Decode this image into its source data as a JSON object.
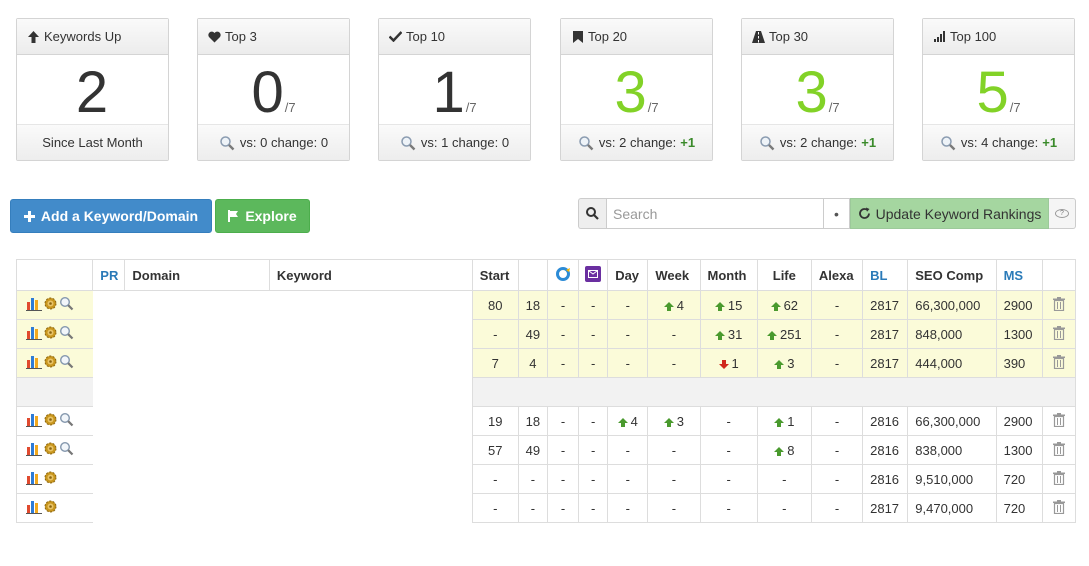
{
  "cards": [
    {
      "icon": "arrow-up-icon",
      "title": "Keywords Up",
      "value": "2",
      "of": "",
      "footer_vs": "Since Last Month",
      "change": "",
      "green": false,
      "search": false
    },
    {
      "icon": "heart-icon",
      "title": "Top 3",
      "value": "0",
      "of": "/7",
      "footer_vs": "vs: 0 change: 0",
      "change": "",
      "green": false,
      "search": true
    },
    {
      "icon": "checkmark-icon",
      "title": "Top 10",
      "value": "1",
      "of": "/7",
      "footer_vs": "vs: 1 change: 0",
      "change": "",
      "green": false,
      "search": true
    },
    {
      "icon": "bookmark-icon",
      "title": "Top 20",
      "value": "3",
      "of": "/7",
      "footer_vs": "vs: 2 change:",
      "change": "+1",
      "green": true,
      "search": true
    },
    {
      "icon": "road-icon",
      "title": "Top 30",
      "value": "3",
      "of": "/7",
      "footer_vs": "vs: 2 change:",
      "change": "+1",
      "green": true,
      "search": true
    },
    {
      "icon": "signal-icon",
      "title": "Top 100",
      "value": "5",
      "of": "/7",
      "footer_vs": "vs: 4 change:",
      "change": "+1",
      "green": true,
      "search": true
    }
  ],
  "toolbar": {
    "add_label": "Add a Keyword/Domain",
    "explore_label": "Explore",
    "search_placeholder": "Search",
    "dot": "•",
    "update_label": "Update Keyword Rankings",
    "help": "?"
  },
  "table": {
    "headers": {
      "pr": "PR",
      "domain": "Domain",
      "keyword": "Keyword",
      "start": "Start",
      "day": "Day",
      "week": "Week",
      "month": "Month",
      "life": "Life",
      "alexa": "Alexa",
      "bl": "BL",
      "seo": "SEO Comp",
      "ms": "MS"
    },
    "rows": [
      {
        "kind": "yellow",
        "search": true,
        "start": "80",
        "cur": "18",
        "bing": "-",
        "yahoo": "-",
        "day": "-",
        "day_dir": "",
        "week": "4",
        "week_dir": "up",
        "month": "15",
        "month_dir": "up",
        "life": "62",
        "life_dir": "up",
        "alexa": "-",
        "bl": "2817",
        "seo": "66,300,000",
        "ms": "2900"
      },
      {
        "kind": "yellow",
        "search": true,
        "start": "-",
        "cur": "49",
        "bing": "-",
        "yahoo": "-",
        "day": "-",
        "day_dir": "",
        "week": "-",
        "week_dir": "",
        "month": "31",
        "month_dir": "up",
        "life": "251",
        "life_dir": "up",
        "alexa": "-",
        "bl": "2817",
        "seo": "848,000",
        "ms": "1300"
      },
      {
        "kind": "yellow",
        "search": true,
        "start": "7",
        "cur": "4",
        "bing": "-",
        "yahoo": "-",
        "day": "-",
        "day_dir": "",
        "week": "-",
        "week_dir": "",
        "month": "1",
        "month_dir": "down",
        "life": "3",
        "life_dir": "up",
        "alexa": "-",
        "bl": "2817",
        "seo": "444,000",
        "ms": "390"
      },
      {
        "kind": "sep"
      },
      {
        "kind": "white",
        "search": true,
        "start": "19",
        "cur": "18",
        "bing": "-",
        "yahoo": "-",
        "day": "4",
        "day_dir": "up",
        "week": "3",
        "week_dir": "up",
        "month": "-",
        "month_dir": "",
        "life": "1",
        "life_dir": "up",
        "alexa": "-",
        "bl": "2816",
        "seo": "66,300,000",
        "ms": "2900"
      },
      {
        "kind": "white",
        "search": true,
        "start": "57",
        "cur": "49",
        "bing": "-",
        "yahoo": "-",
        "day": "-",
        "day_dir": "",
        "week": "-",
        "week_dir": "",
        "month": "-",
        "month_dir": "",
        "life": "8",
        "life_dir": "up",
        "alexa": "-",
        "bl": "2816",
        "seo": "838,000",
        "ms": "1300"
      },
      {
        "kind": "white",
        "search": false,
        "start": "-",
        "cur": "-",
        "bing": "-",
        "yahoo": "-",
        "day": "-",
        "day_dir": "",
        "week": "-",
        "week_dir": "",
        "month": "-",
        "month_dir": "",
        "life": "-",
        "life_dir": "",
        "alexa": "-",
        "bl": "2816",
        "seo": "9,510,000",
        "ms": "720"
      },
      {
        "kind": "white",
        "search": false,
        "start": "-",
        "cur": "-",
        "bing": "-",
        "yahoo": "-",
        "day": "-",
        "day_dir": "",
        "week": "-",
        "week_dir": "",
        "month": "-",
        "month_dir": "",
        "life": "-",
        "life_dir": "",
        "alexa": "-",
        "bl": "2817",
        "seo": "9,470,000",
        "ms": "720"
      }
    ]
  },
  "colors": {
    "green_value": "#82d227",
    "blue_button": "#428bca",
    "green_button": "#5cb85c",
    "update_bg": "#a5d6a0",
    "yellow_row": "#fbfbd9",
    "arrow_up": "#4a9a2e",
    "arrow_down": "#d0281c"
  }
}
